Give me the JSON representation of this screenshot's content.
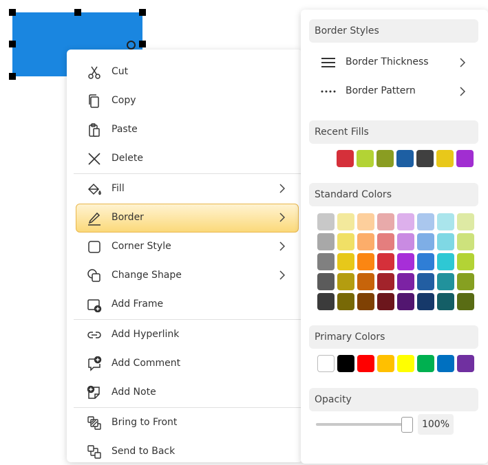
{
  "canvas": {
    "shape_color": "#1a86e0"
  },
  "context_menu": {
    "items": [
      {
        "label": "Cut",
        "icon": "scissors-icon"
      },
      {
        "label": "Copy",
        "icon": "copy-icon"
      },
      {
        "label": "Paste",
        "icon": "paste-icon"
      },
      {
        "label": "Delete",
        "icon": "close-icon"
      },
      {
        "label": "Fill",
        "icon": "paint-bucket-icon"
      },
      {
        "label": "Border",
        "icon": "pen-icon"
      },
      {
        "label": "Corner Style",
        "icon": "rounded-square-icon"
      },
      {
        "label": "Change Shape",
        "icon": "change-shape-icon"
      },
      {
        "label": "Add Frame",
        "icon": "add-frame-icon"
      },
      {
        "label": "Add Hyperlink",
        "icon": "link-icon"
      },
      {
        "label": "Add Comment",
        "icon": "add-comment-icon"
      },
      {
        "label": "Add Note",
        "icon": "add-note-icon"
      },
      {
        "label": "Bring to Front",
        "icon": "bring-to-front-icon"
      },
      {
        "label": "Send to Back",
        "icon": "send-to-back-icon"
      }
    ],
    "highlighted": "Border",
    "highlight_color": "#fbd97a"
  },
  "border_panel": {
    "border_styles": {
      "title": "Border Styles",
      "items": [
        {
          "label": "Border Thickness",
          "icon": "lines-icon"
        },
        {
          "label": "Border Pattern",
          "icon": "dotted-line-icon"
        }
      ]
    },
    "recent_fills": {
      "title": "Recent Fills",
      "colors": [
        "#d5303a",
        "#b3d335",
        "#8a9d22",
        "#1d5fa3",
        "#404040",
        "#e8c81a",
        "#a12ed1"
      ]
    },
    "standard_colors": {
      "title": "Standard Colors",
      "rows": [
        [
          "#c8c8c8",
          "#f3e99c",
          "#fdcf9c",
          "#e8aaaa",
          "#ddb0ec",
          "#aac7ee",
          "#aae5ec",
          "#deeaa4"
        ],
        [
          "#a8a8a8",
          "#f0e066",
          "#fcad6a",
          "#e47e7e",
          "#c98be2",
          "#7eaee6",
          "#7fd8e4",
          "#cde27c"
        ],
        [
          "#808080",
          "#e7c81a",
          "#fb8612",
          "#d5303a",
          "#a72ed8",
          "#2f7ed6",
          "#2ec8d4",
          "#b3d335"
        ],
        [
          "#5b5b5b",
          "#b49d10",
          "#c7640a",
          "#a2232b",
          "#7c22a4",
          "#225ea2",
          "#21929c",
          "#86a021"
        ],
        [
          "#3b3b3b",
          "#786906",
          "#7f4104",
          "#6c161c",
          "#521670",
          "#16396a",
          "#145e66",
          "#596c14"
        ]
      ]
    },
    "primary_colors": {
      "title": "Primary Colors",
      "colors": [
        "#ffffff",
        "#000000",
        "#ff0000",
        "#ffc000",
        "#ffff00",
        "#00b050",
        "#0070c0",
        "#7030a0"
      ]
    },
    "opacity": {
      "title": "Opacity",
      "value_label": "100%",
      "value": 1.0
    }
  }
}
